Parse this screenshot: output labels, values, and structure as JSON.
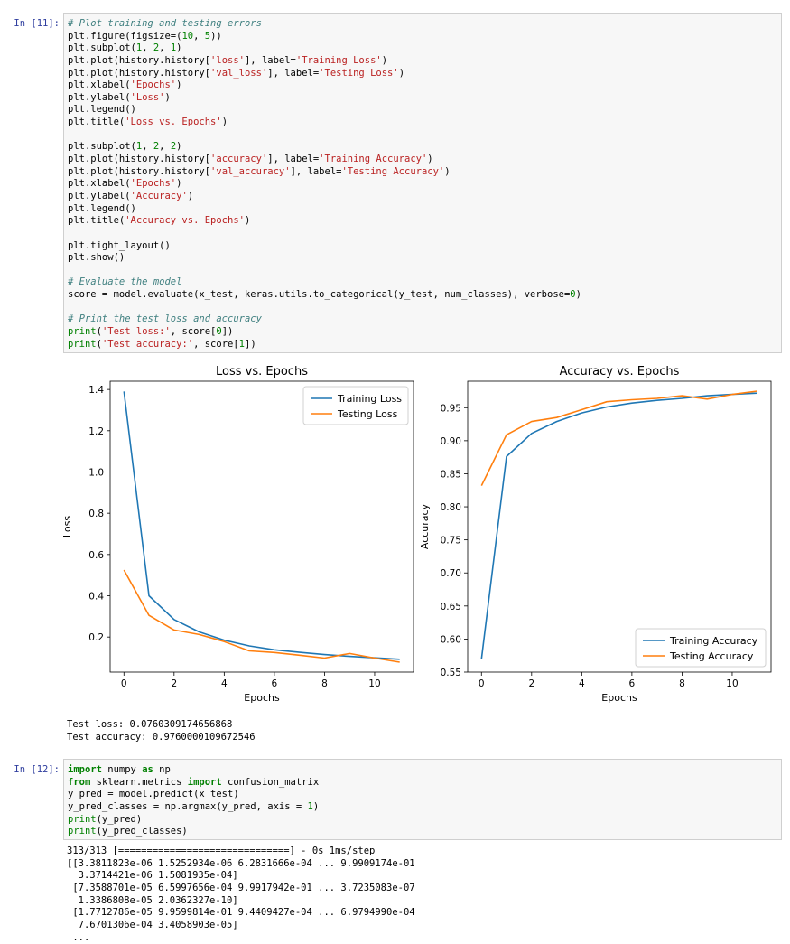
{
  "cell11": {
    "prompt": "In [11]:",
    "code_lines": [
      [
        {
          "t": "# Plot training and testing errors",
          "c": "c"
        }
      ],
      [
        {
          "t": "plt.figure(figsize=(",
          "c": ""
        },
        {
          "t": "10",
          "c": "n"
        },
        {
          "t": ", ",
          "c": ""
        },
        {
          "t": "5",
          "c": "n"
        },
        {
          "t": "))",
          "c": ""
        }
      ],
      [
        {
          "t": "plt.subplot(",
          "c": ""
        },
        {
          "t": "1",
          "c": "n"
        },
        {
          "t": ", ",
          "c": ""
        },
        {
          "t": "2",
          "c": "n"
        },
        {
          "t": ", ",
          "c": ""
        },
        {
          "t": "1",
          "c": "n"
        },
        {
          "t": ")",
          "c": ""
        }
      ],
      [
        {
          "t": "plt.plot(history.history[",
          "c": ""
        },
        {
          "t": "'loss'",
          "c": "s"
        },
        {
          "t": "], label=",
          "c": ""
        },
        {
          "t": "'Training Loss'",
          "c": "s"
        },
        {
          "t": ")",
          "c": ""
        }
      ],
      [
        {
          "t": "plt.plot(history.history[",
          "c": ""
        },
        {
          "t": "'val_loss'",
          "c": "s"
        },
        {
          "t": "], label=",
          "c": ""
        },
        {
          "t": "'Testing Loss'",
          "c": "s"
        },
        {
          "t": ")",
          "c": ""
        }
      ],
      [
        {
          "t": "plt.xlabel(",
          "c": ""
        },
        {
          "t": "'Epochs'",
          "c": "s"
        },
        {
          "t": ")",
          "c": ""
        }
      ],
      [
        {
          "t": "plt.ylabel(",
          "c": ""
        },
        {
          "t": "'Loss'",
          "c": "s"
        },
        {
          "t": ")",
          "c": ""
        }
      ],
      [
        {
          "t": "plt.legend()",
          "c": ""
        }
      ],
      [
        {
          "t": "plt.title(",
          "c": ""
        },
        {
          "t": "'Loss vs. Epochs'",
          "c": "s"
        },
        {
          "t": ")",
          "c": ""
        }
      ],
      [],
      [
        {
          "t": "plt.subplot(",
          "c": ""
        },
        {
          "t": "1",
          "c": "n"
        },
        {
          "t": ", ",
          "c": ""
        },
        {
          "t": "2",
          "c": "n"
        },
        {
          "t": ", ",
          "c": ""
        },
        {
          "t": "2",
          "c": "n"
        },
        {
          "t": ")",
          "c": ""
        }
      ],
      [
        {
          "t": "plt.plot(history.history[",
          "c": ""
        },
        {
          "t": "'accuracy'",
          "c": "s"
        },
        {
          "t": "], label=",
          "c": ""
        },
        {
          "t": "'Training Accuracy'",
          "c": "s"
        },
        {
          "t": ")",
          "c": ""
        }
      ],
      [
        {
          "t": "plt.plot(history.history[",
          "c": ""
        },
        {
          "t": "'val_accuracy'",
          "c": "s"
        },
        {
          "t": "], label=",
          "c": ""
        },
        {
          "t": "'Testing Accuracy'",
          "c": "s"
        },
        {
          "t": ")",
          "c": ""
        }
      ],
      [
        {
          "t": "plt.xlabel(",
          "c": ""
        },
        {
          "t": "'Epochs'",
          "c": "s"
        },
        {
          "t": ")",
          "c": ""
        }
      ],
      [
        {
          "t": "plt.ylabel(",
          "c": ""
        },
        {
          "t": "'Accuracy'",
          "c": "s"
        },
        {
          "t": ")",
          "c": ""
        }
      ],
      [
        {
          "t": "plt.legend()",
          "c": ""
        }
      ],
      [
        {
          "t": "plt.title(",
          "c": ""
        },
        {
          "t": "'Accuracy vs. Epochs'",
          "c": "s"
        },
        {
          "t": ")",
          "c": ""
        }
      ],
      [],
      [
        {
          "t": "plt.tight_layout()",
          "c": ""
        }
      ],
      [
        {
          "t": "plt.show()",
          "c": ""
        }
      ],
      [],
      [
        {
          "t": "# Evaluate the model",
          "c": "c"
        }
      ],
      [
        {
          "t": "score = model.evaluate(x_test, keras.utils.to_categorical(y_test, num_classes), verbose=",
          "c": ""
        },
        {
          "t": "0",
          "c": "n"
        },
        {
          "t": ")",
          "c": ""
        }
      ],
      [],
      [
        {
          "t": "# Print the test loss and accuracy",
          "c": "c"
        }
      ],
      [
        {
          "t": "print",
          "c": "n"
        },
        {
          "t": "(",
          "c": ""
        },
        {
          "t": "'Test loss:'",
          "c": "s"
        },
        {
          "t": ", score[",
          "c": ""
        },
        {
          "t": "0",
          "c": "n"
        },
        {
          "t": "])",
          "c": ""
        }
      ],
      [
        {
          "t": "print",
          "c": "n"
        },
        {
          "t": "(",
          "c": ""
        },
        {
          "t": "'Test accuracy:'",
          "c": "s"
        },
        {
          "t": ", score[",
          "c": ""
        },
        {
          "t": "1",
          "c": "n"
        },
        {
          "t": "])",
          "c": ""
        }
      ]
    ],
    "stdout": "Test loss: 0.0760309174656868\nTest accuracy: 0.9760000109672546"
  },
  "cell12": {
    "prompt": "In [12]:",
    "code_lines": [
      [
        {
          "t": "import",
          "c": "k"
        },
        {
          "t": " numpy ",
          "c": ""
        },
        {
          "t": "as",
          "c": "k"
        },
        {
          "t": " np",
          "c": ""
        }
      ],
      [
        {
          "t": "from",
          "c": "k"
        },
        {
          "t": " sklearn.metrics ",
          "c": ""
        },
        {
          "t": "import",
          "c": "k"
        },
        {
          "t": " confusion_matrix",
          "c": ""
        }
      ],
      [
        {
          "t": "y_pred = model.predict(x_test)",
          "c": ""
        }
      ],
      [
        {
          "t": "y_pred_classes = np.argmax(y_pred, axis = ",
          "c": ""
        },
        {
          "t": "1",
          "c": "n"
        },
        {
          "t": ")",
          "c": ""
        }
      ],
      [
        {
          "t": "print",
          "c": "n"
        },
        {
          "t": "(y_pred)",
          "c": ""
        }
      ],
      [
        {
          "t": "print",
          "c": "n"
        },
        {
          "t": "(y_pred_classes)",
          "c": ""
        }
      ]
    ],
    "stdout": "313/313 [==============================] - 0s 1ms/step\n[[3.3811823e-06 1.5252934e-06 6.2831666e-04 ... 9.9909174e-01\n  3.3714421e-06 1.5081935e-04]\n [7.3588701e-05 6.5997656e-04 9.9917942e-01 ... 3.7235083e-07\n  1.3386808e-05 2.0362327e-10]\n [1.7712786e-05 9.9599814e-01 9.4409427e-04 ... 6.9794990e-04\n  7.6701306e-04 3.4058903e-05]\n ..."
  },
  "colors": {
    "training": "#1f77b4",
    "testing": "#ff7f0e",
    "prompt": "#303f9f",
    "cell_background": "#f7f7f7"
  },
  "chart_data": [
    {
      "type": "line",
      "title": "Loss vs. Epochs",
      "xlabel": "Epochs",
      "ylabel": "Loss",
      "xlim": [
        -0.55,
        11.55
      ],
      "ylim": [
        0.03,
        1.44
      ],
      "xticks": [
        0,
        2,
        4,
        6,
        8,
        10
      ],
      "yticks": [
        0.2,
        0.4,
        0.6,
        0.8,
        1.0,
        1.2,
        1.4
      ],
      "ytick_labels": [
        "0.2",
        "0.4",
        "0.6",
        "0.8",
        "1.0",
        "1.2",
        "1.4"
      ],
      "legend_position": "top-right",
      "grid": false,
      "x": [
        0,
        1,
        2,
        3,
        4,
        5,
        6,
        7,
        8,
        9,
        10,
        11
      ],
      "series": [
        {
          "name": "Training Loss",
          "color": "#1f77b4",
          "values": [
            1.39,
            0.4,
            0.285,
            0.225,
            0.185,
            0.157,
            0.138,
            0.126,
            0.115,
            0.106,
            0.099,
            0.092
          ]
        },
        {
          "name": "Testing Loss",
          "color": "#ff7f0e",
          "values": [
            0.525,
            0.305,
            0.234,
            0.212,
            0.178,
            0.133,
            0.125,
            0.112,
            0.098,
            0.12,
            0.098,
            0.078
          ]
        }
      ]
    },
    {
      "type": "line",
      "title": "Accuracy vs. Epochs",
      "xlabel": "Epochs",
      "ylabel": "Accuracy",
      "xlim": [
        -0.55,
        11.55
      ],
      "ylim": [
        0.55,
        0.99
      ],
      "xticks": [
        0,
        2,
        4,
        6,
        8,
        10
      ],
      "yticks": [
        0.55,
        0.6,
        0.65,
        0.7,
        0.75,
        0.8,
        0.85,
        0.9,
        0.95
      ],
      "ytick_labels": [
        "0.55",
        "0.60",
        "0.65",
        "0.70",
        "0.75",
        "0.80",
        "0.85",
        "0.90",
        "0.95"
      ],
      "legend_position": "bottom-right",
      "grid": false,
      "x": [
        0,
        1,
        2,
        3,
        4,
        5,
        6,
        7,
        8,
        9,
        10,
        11
      ],
      "series": [
        {
          "name": "Training Accuracy",
          "color": "#1f77b4",
          "values": [
            0.57,
            0.876,
            0.911,
            0.929,
            0.942,
            0.951,
            0.957,
            0.961,
            0.964,
            0.968,
            0.97,
            0.972
          ]
        },
        {
          "name": "Testing Accuracy",
          "color": "#ff7f0e",
          "values": [
            0.832,
            0.909,
            0.929,
            0.935,
            0.947,
            0.959,
            0.962,
            0.964,
            0.968,
            0.963,
            0.97,
            0.975
          ]
        }
      ]
    }
  ]
}
